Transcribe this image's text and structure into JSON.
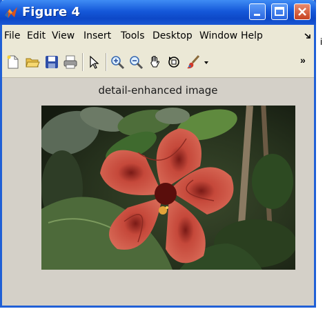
{
  "window": {
    "title": "Figure 4"
  },
  "menu": {
    "items": [
      "File",
      "Edit",
      "View",
      "Insert",
      "Tools",
      "Desktop",
      "Window",
      "Help"
    ],
    "overflow_icon": "menu-overflow-arrow-icon"
  },
  "toolbar": {
    "tools": [
      "new-figure-icon",
      "open-file-icon",
      "save-figure-icon",
      "print-figure-icon",
      "edit-plot-arrow-icon",
      "zoom-in-icon",
      "zoom-out-icon",
      "pan-hand-icon",
      "rotate-3d-icon",
      "data-cursor-brush-icon"
    ],
    "overflow_icon": "toolbar-overflow-chevron-icon"
  },
  "figure": {
    "title": "detail-enhanced image"
  },
  "colors": {
    "titlebar": "#1558d9",
    "menubar": "#ebe8d6",
    "figure_bg": "#d4d0c8"
  }
}
